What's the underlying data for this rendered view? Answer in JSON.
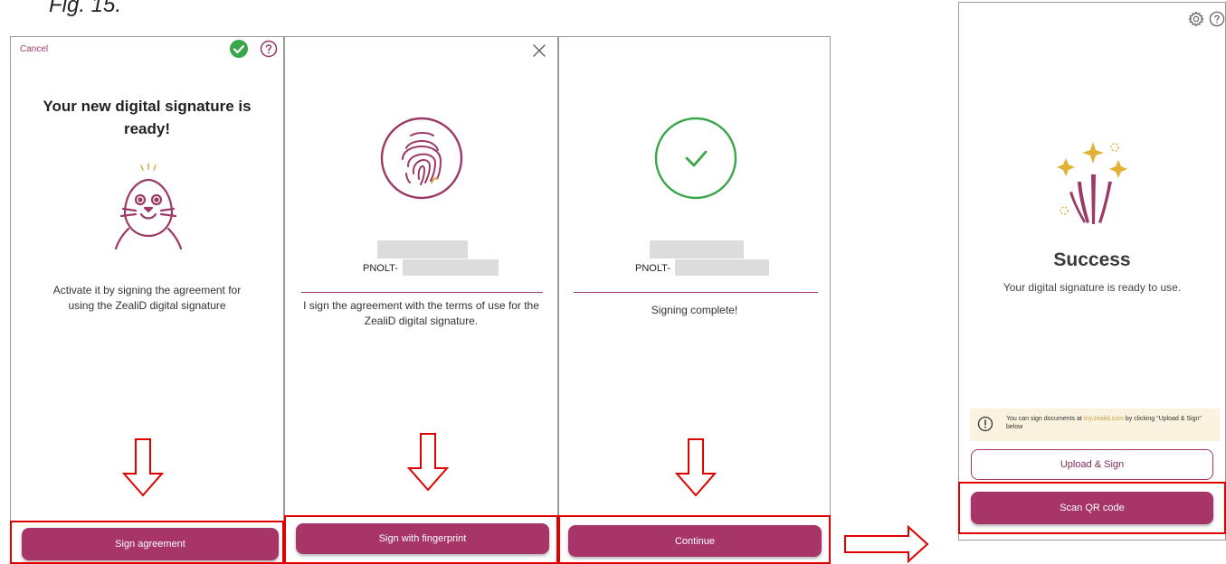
{
  "figure_label": "Fig. 15.",
  "screen1": {
    "cancel_label": "Cancel",
    "title": "Your new digital signature is ready!",
    "body": "Activate it by signing the agreement for using the ZealiD digital signature",
    "button_label": "Sign agreement",
    "icons": [
      "check-circle-icon",
      "help-icon",
      "seal-mascot-icon"
    ]
  },
  "screen2": {
    "id_prefix": "PNOLT-",
    "body": "I sign the agreement with the terms of use for the ZealiD digital signature.",
    "button_label": "Sign with fingerprint",
    "icons": [
      "close-icon",
      "fingerprint-icon"
    ]
  },
  "screen3": {
    "id_prefix": "PNOLT-",
    "body": "Signing complete!",
    "button_label": "Continue",
    "icons": [
      "success-check-icon"
    ]
  },
  "screen4": {
    "title": "Success",
    "subtitle": "Your digital signature is ready to use.",
    "notice_prefix": "You can sign documents at ",
    "notice_link": "my.zealid.com",
    "notice_suffix": " by clicking \"Upload & Sign\" below",
    "upload_button_label": "Upload & Sign",
    "scan_button_label": "Scan QR code",
    "icons": [
      "settings-icon",
      "help-icon",
      "celebration-icon",
      "info-icon"
    ]
  },
  "colors": {
    "brand": "#a83568",
    "success": "#3aa64a",
    "highlight": "#e00000"
  }
}
